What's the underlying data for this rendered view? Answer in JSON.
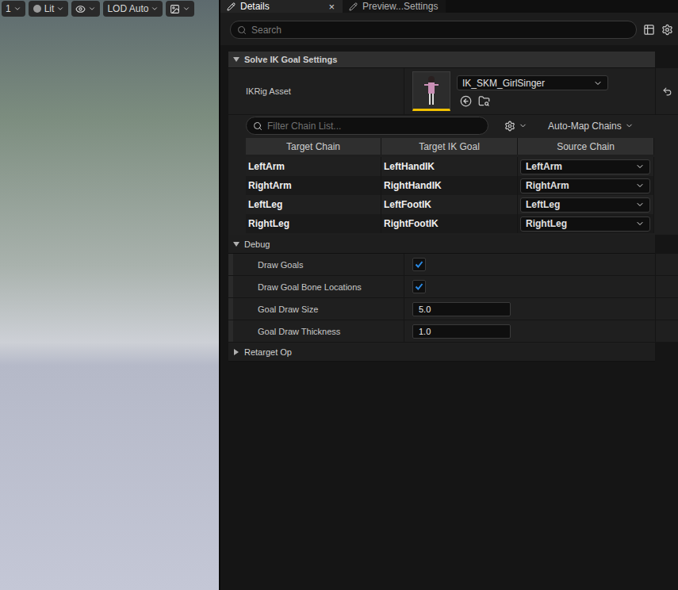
{
  "viewport": {
    "toolbar": [
      {
        "label": "1",
        "kind": "text"
      },
      {
        "label": "Lit",
        "kind": "lit"
      },
      {
        "label": "",
        "kind": "eye"
      },
      {
        "label": "LOD Auto",
        "kind": "text"
      },
      {
        "label": "",
        "kind": "image"
      }
    ]
  },
  "tabs": [
    {
      "label": "Details",
      "selected": true,
      "close": "×"
    },
    {
      "label": "Preview...Settings",
      "selected": false,
      "close": ""
    }
  ],
  "search": {
    "placeholder": "Search"
  },
  "sections": [
    {
      "title": "Solve IK Goal Settings",
      "expanded": true
    },
    {
      "title": "Debug",
      "expanded": true
    },
    {
      "title": "Retarget Op",
      "expanded": false
    }
  ],
  "ikrig": {
    "label": "IKRig Asset",
    "value": "IK_SKM_GirlSinger"
  },
  "chains": {
    "filter_placeholder": "Filter Chain List...",
    "auto_map": "Auto-Map Chains",
    "columns": [
      "Target Chain",
      "Target IK Goal",
      "Source Chain"
    ],
    "rows": [
      {
        "target": "LeftArm",
        "goal": "LeftHandIK",
        "source": "LeftArm"
      },
      {
        "target": "RightArm",
        "goal": "RightHandIK",
        "source": "RightArm"
      },
      {
        "target": "LeftLeg",
        "goal": "LeftFootIK",
        "source": "LeftLeg"
      },
      {
        "target": "RightLeg",
        "goal": "RightFootIK",
        "source": "RightLeg"
      }
    ]
  },
  "debug": [
    {
      "label": "Draw Goals",
      "kind": "checkbox",
      "checked": true,
      "value": ""
    },
    {
      "label": "Draw Goal Bone Locations",
      "kind": "checkbox",
      "checked": true,
      "value": ""
    },
    {
      "label": "Goal Draw Size",
      "kind": "number",
      "checked": false,
      "value": "5.0"
    },
    {
      "label": "Goal Draw Thickness",
      "kind": "number",
      "checked": false,
      "value": "1.0"
    }
  ]
}
